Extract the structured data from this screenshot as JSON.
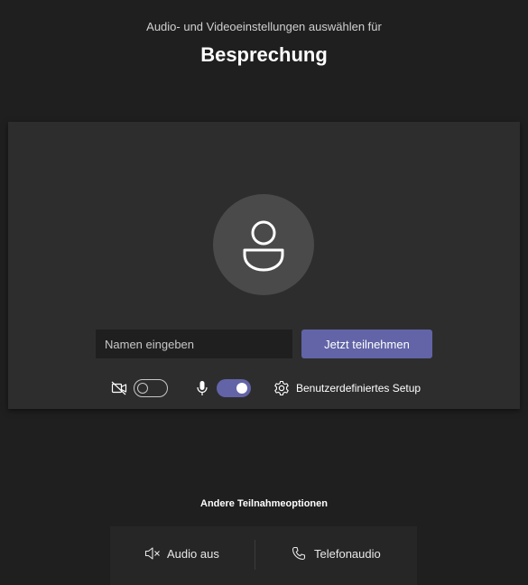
{
  "header": {
    "subtitle": "Audio- und Videoeinstellungen auswählen für",
    "title": "Besprechung"
  },
  "preview": {
    "avatar_icon": "person-icon",
    "name_input": {
      "value": "",
      "placeholder": "Namen eingeben"
    },
    "join_label": "Jetzt teilnehmen",
    "accent_color": "#6264a7"
  },
  "controls": {
    "camera": {
      "icon": "camera-off-icon",
      "enabled": false
    },
    "microphone": {
      "icon": "microphone-icon",
      "enabled": true
    },
    "setup": {
      "icon": "gear-icon",
      "label": "Benutzerdefiniertes Setup"
    }
  },
  "other_options": {
    "heading": "Andere Teilnahmeoptionen",
    "items": [
      {
        "icon": "speaker-muted-icon",
        "label": "Audio aus"
      },
      {
        "icon": "phone-icon",
        "label": "Telefonaudio"
      }
    ]
  }
}
